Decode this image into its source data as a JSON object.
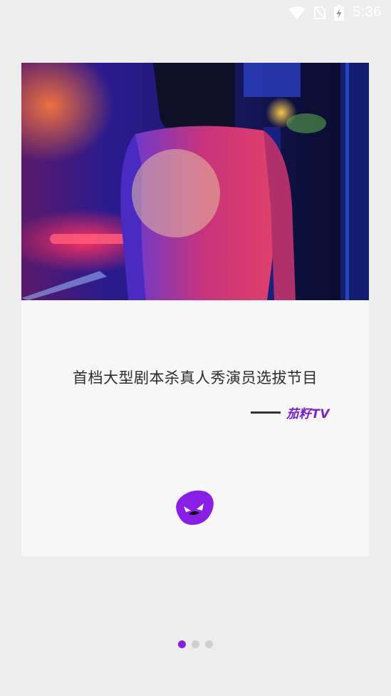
{
  "status_bar": {
    "time": "5:36",
    "icons": [
      "wifi-icon",
      "no-sim-icon",
      "battery-charging-icon"
    ]
  },
  "onboarding": {
    "hero_image": "person-neon-lights-photo",
    "headline": "首档大型剧本杀真人秀演员选拔节目",
    "brand_name": "茄籽TV",
    "logo_icon": "qiezi-face-logo-icon",
    "accent_color": "#8a1de6"
  },
  "pager": {
    "total": 3,
    "active_index": 0
  }
}
